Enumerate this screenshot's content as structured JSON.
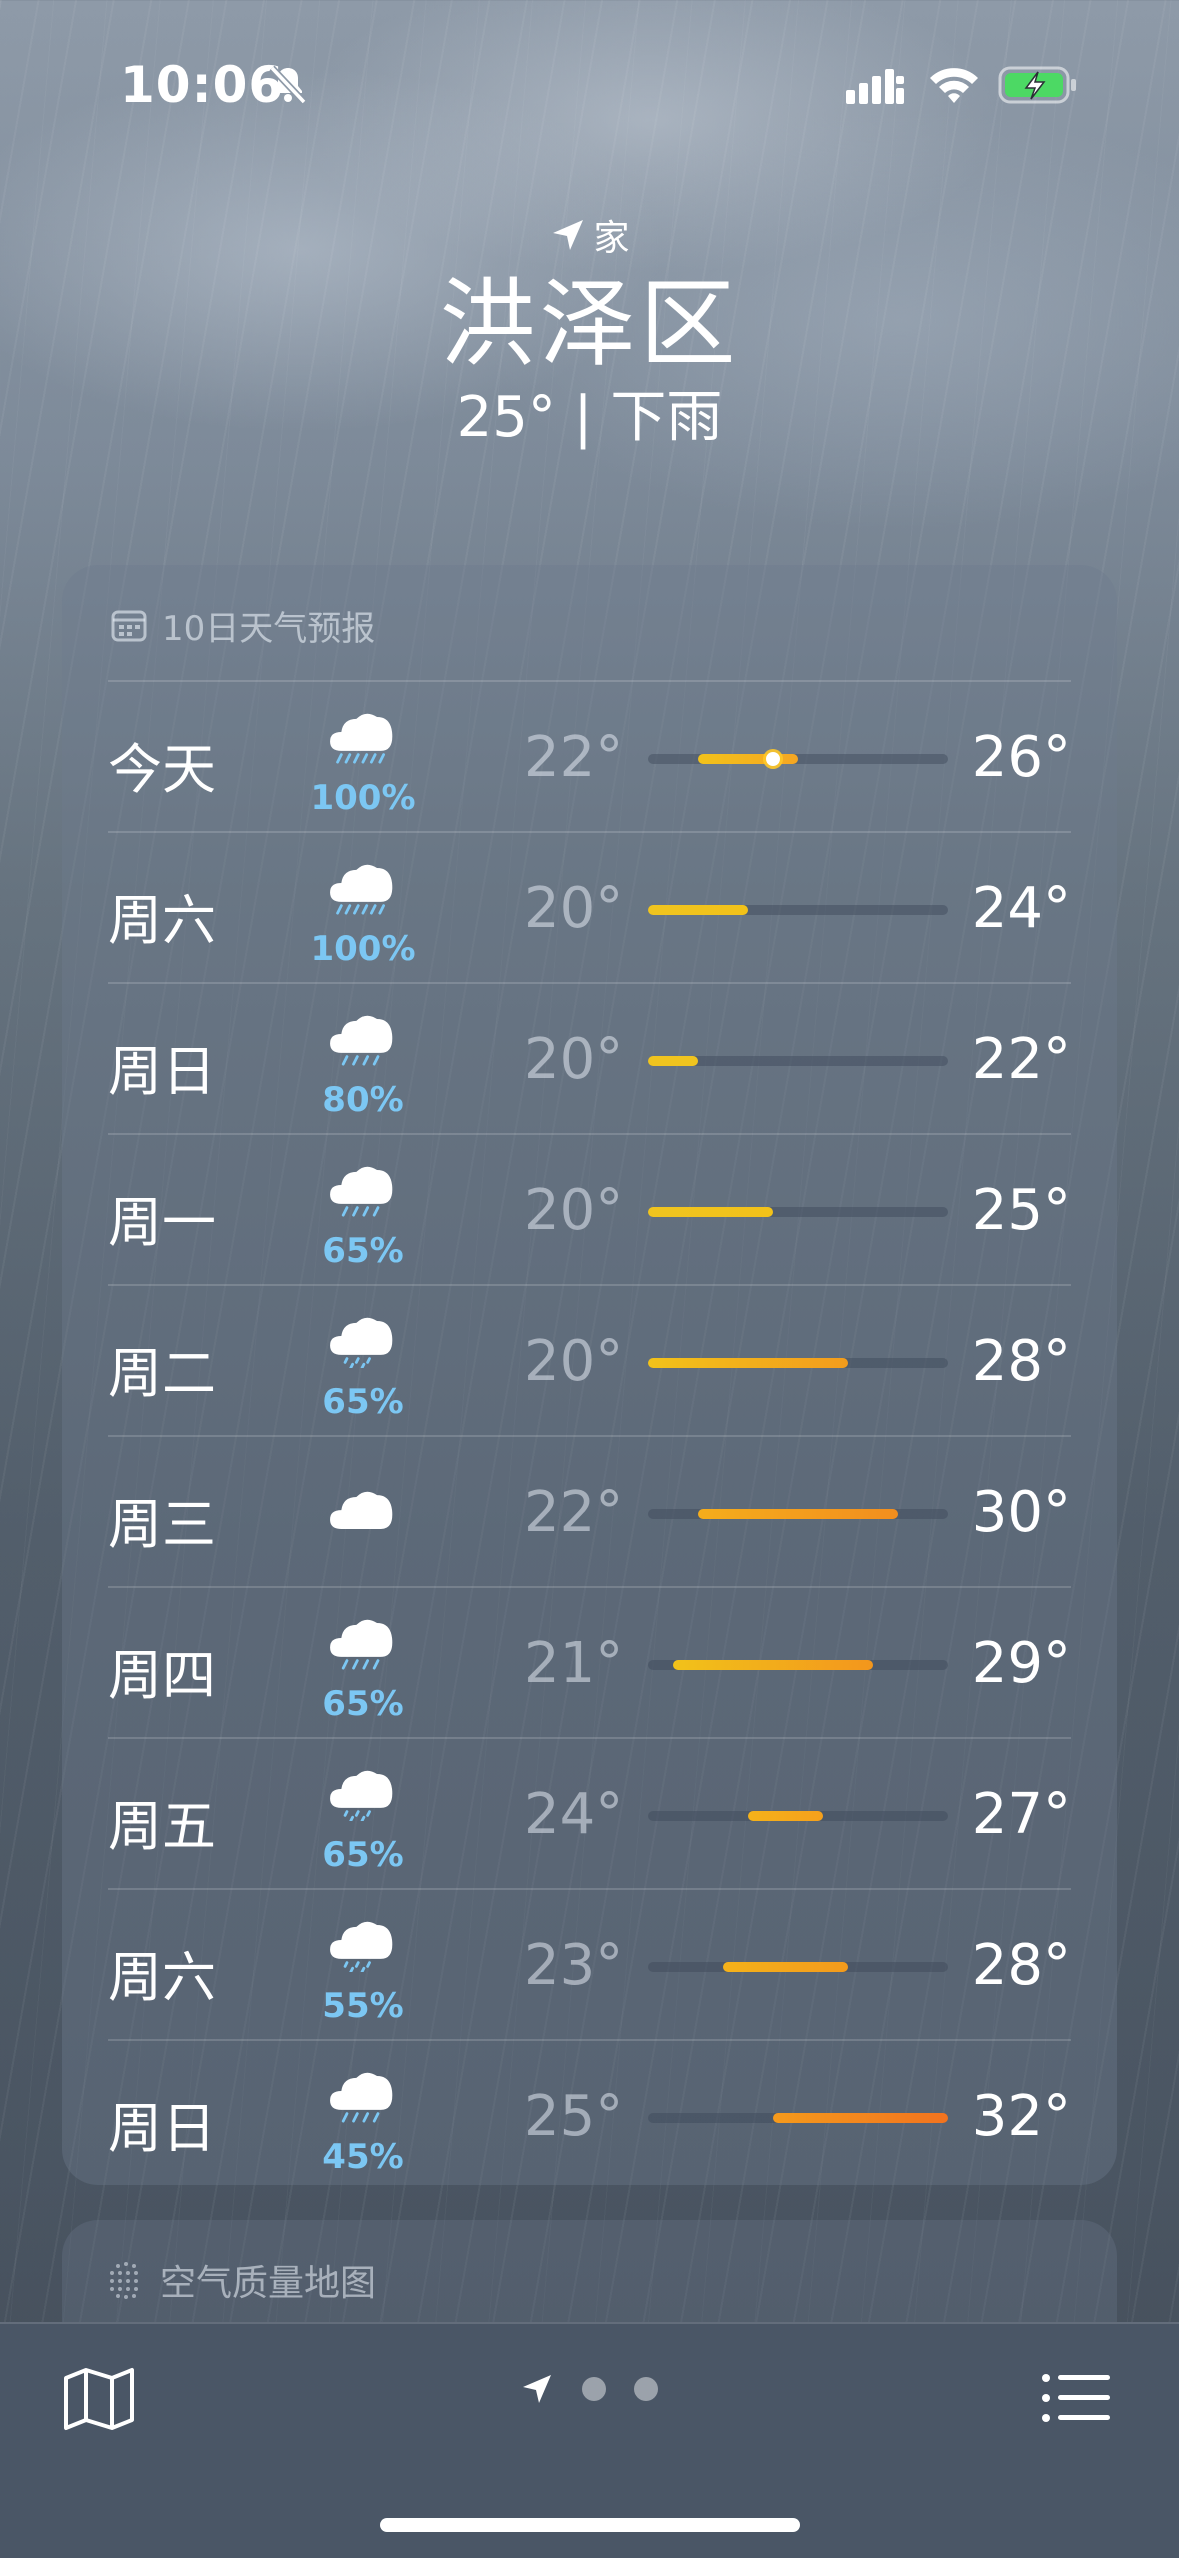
{
  "status_bar": {
    "time": "10:06"
  },
  "header": {
    "home_label": "家",
    "city": "洪泽区",
    "condition": "25° | 下雨"
  },
  "forecast": {
    "title": "10日天气预报",
    "range_min": 20,
    "range_max": 32,
    "current_temp": 25,
    "days": [
      {
        "day": "今天",
        "icon": "heavy-rain-cloud-icon",
        "precip": "100%",
        "low": "22°",
        "high": "26°",
        "low_val": 22,
        "high_val": 26,
        "bar_start_color": "#f2c21a",
        "bar_end_color": "#f5a623",
        "current": true
      },
      {
        "day": "周六",
        "icon": "heavy-rain-cloud-icon",
        "precip": "100%",
        "low": "20°",
        "high": "24°",
        "low_val": 20,
        "high_val": 24,
        "bar_start_color": "#f0c41f",
        "bar_end_color": "#f2c21a"
      },
      {
        "day": "周日",
        "icon": "rain-cloud-icon",
        "precip": "80%",
        "low": "20°",
        "high": "22°",
        "low_val": 20,
        "high_val": 22,
        "bar_start_color": "#f0c41f",
        "bar_end_color": "#f0c41f"
      },
      {
        "day": "周一",
        "icon": "rain-cloud-icon",
        "precip": "65%",
        "low": "20°",
        "high": "25°",
        "low_val": 20,
        "high_val": 25,
        "bar_start_color": "#f0c41f",
        "bar_end_color": "#f2c21a"
      },
      {
        "day": "周二",
        "icon": "drizzle-cloud-icon",
        "precip": "65%",
        "low": "20°",
        "high": "28°",
        "low_val": 20,
        "high_val": 28,
        "bar_start_color": "#f2c21a",
        "bar_end_color": "#f39c1c"
      },
      {
        "day": "周三",
        "icon": "cloud-icon",
        "precip": "",
        "low": "22°",
        "high": "30°",
        "low_val": 22,
        "high_val": 30,
        "bar_start_color": "#f5ad1c",
        "bar_end_color": "#f28e1e"
      },
      {
        "day": "周四",
        "icon": "rain-cloud-icon",
        "precip": "65%",
        "low": "21°",
        "high": "29°",
        "low_val": 21,
        "high_val": 29,
        "bar_start_color": "#f2c21a",
        "bar_end_color": "#f3961c"
      },
      {
        "day": "周五",
        "icon": "drizzle-cloud-icon",
        "precip": "65%",
        "low": "24°",
        "high": "27°",
        "low_val": 24,
        "high_val": 27,
        "bar_start_color": "#f5b21a",
        "bar_end_color": "#f5a01c"
      },
      {
        "day": "周六",
        "icon": "drizzle-cloud-icon",
        "precip": "55%",
        "low": "23°",
        "high": "28°",
        "low_val": 23,
        "high_val": 28,
        "bar_start_color": "#f5b21a",
        "bar_end_color": "#f39a1c"
      },
      {
        "day": "周日",
        "icon": "rain-cloud-icon",
        "precip": "45%",
        "low": "25°",
        "high": "32°",
        "low_val": 25,
        "high_val": 32,
        "bar_start_color": "#f59a1c",
        "bar_end_color": "#f2731f"
      }
    ]
  },
  "air_quality": {
    "title": "空气质量地图"
  },
  "toolbar": {
    "page_dots": 2
  }
}
